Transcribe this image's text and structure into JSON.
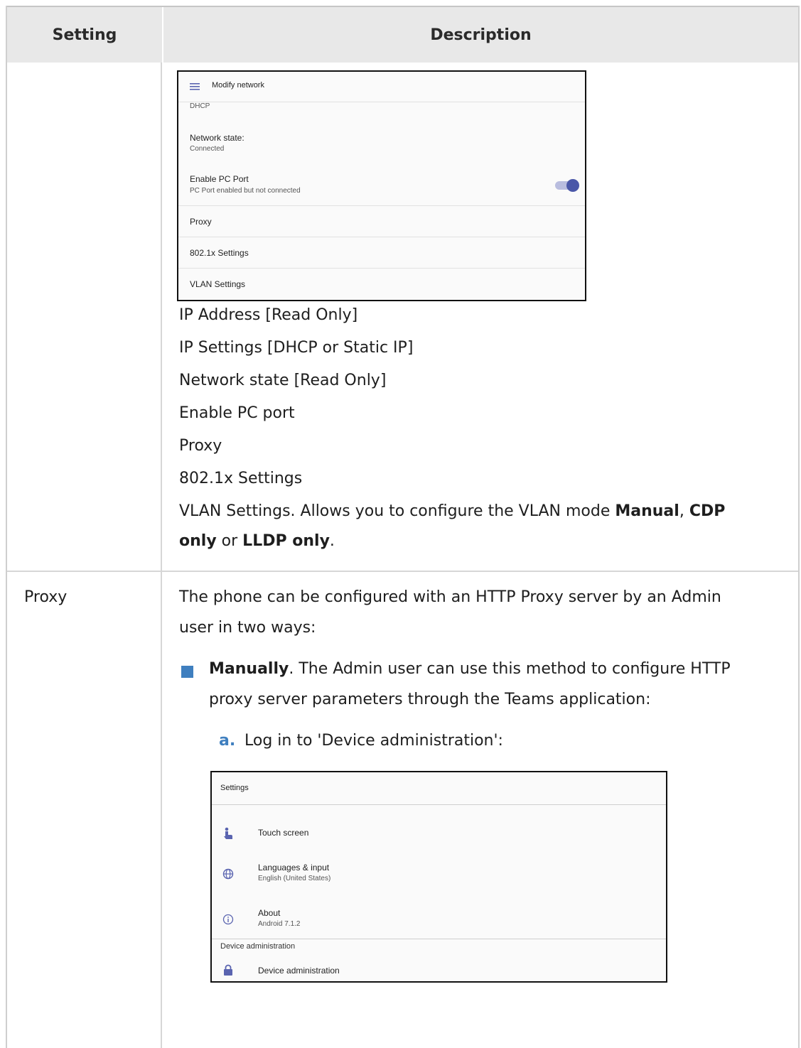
{
  "header": {
    "setting": "Setting",
    "description": "Description"
  },
  "row1": {
    "modify_network": {
      "title": "Modify network",
      "dhcp": "DHCP",
      "network_state_label": "Network state:",
      "network_state_value": "Connected",
      "enable_pc_port_label": "Enable PC Port",
      "enable_pc_port_sub": "PC Port enabled but not connected",
      "enable_pc_port_on": true,
      "proxy": "Proxy",
      "dot1x": "802.1x Settings",
      "vlan": "VLAN Settings"
    },
    "lines": [
      "IP Address [Read Only]",
      "IP Settings [DHCP or Static IP]",
      "Network state [Read Only]",
      "Enable PC port",
      "Proxy",
      "802.1x Settings"
    ],
    "vlan_text": {
      "prefix": "VLAN Settings. Allows you to configure the VLAN mode ",
      "manual": "Manual",
      "comma": ",",
      "cdp_a": "CDP",
      "cdp_b": "only",
      "or": " or ",
      "lldp": "LLDP only",
      "period": "."
    }
  },
  "row2": {
    "setting": "Proxy",
    "intro_1": "The phone can be configured with an HTTP Proxy server by an Admin",
    "intro_2": "user in two ways:",
    "bullet_bold": "Manually",
    "bullet_rest": ". The Admin user can use this method to configure HTTP",
    "bullet_line2": "proxy server parameters through the Teams application:",
    "step_letter": "a.",
    "step_text": "Log in to 'Device administration':",
    "settings_screen": {
      "title": "Settings",
      "touch_screen": "Touch screen",
      "languages": "Languages & input",
      "languages_sub": "English (United States)",
      "about": "About",
      "about_sub": "Android 7.1.2",
      "section": "Device administration",
      "device_admin": "Device administration"
    }
  }
}
